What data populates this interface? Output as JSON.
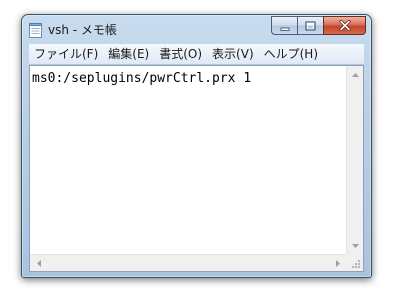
{
  "window": {
    "title": "vsh - メモ帳",
    "icons": {
      "app": "notepad-icon",
      "minimize": "minimize-icon",
      "maximize": "maximize-icon",
      "close": "close-icon"
    },
    "accent_colors": {
      "frame": "#b9d0e8",
      "close_button": "#c4442b"
    }
  },
  "menu": {
    "items": [
      {
        "label": "ファイル(F)"
      },
      {
        "label": "編集(E)"
      },
      {
        "label": "書式(O)"
      },
      {
        "label": "表示(V)"
      },
      {
        "label": "ヘルプ(H)"
      }
    ]
  },
  "editor": {
    "content": "ms0:/seplugins/pwrCtrl.prx 1"
  },
  "scrollbars": {
    "icons": {
      "up": "scroll-up-arrow-icon",
      "down": "scroll-down-arrow-icon",
      "left": "scroll-left-arrow-icon",
      "right": "scroll-right-arrow-icon",
      "grip": "resize-grip-icon"
    }
  }
}
